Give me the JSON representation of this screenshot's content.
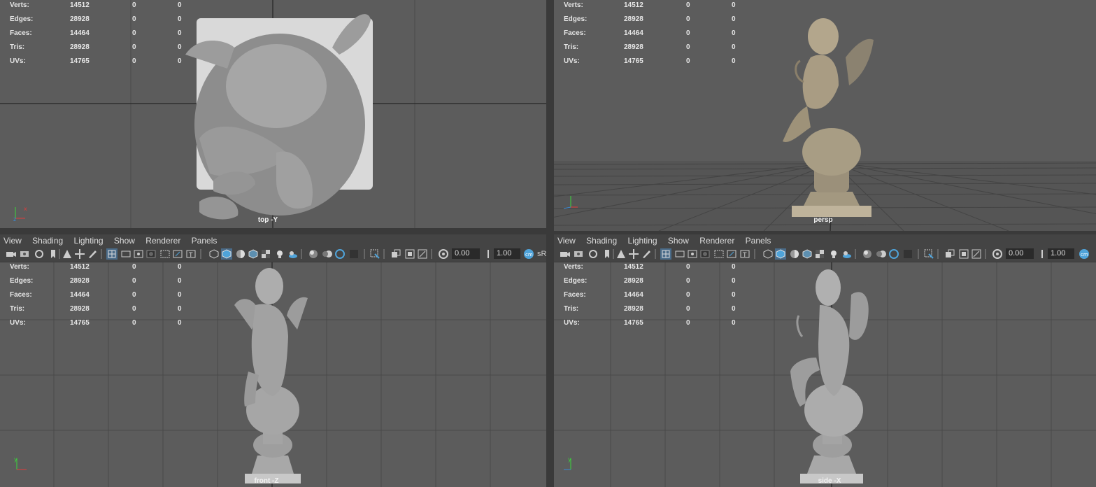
{
  "stats": {
    "labels": [
      "Verts:",
      "Edges:",
      "Faces:",
      "Tris:",
      "UVs:"
    ],
    "values": [
      "14512",
      "28928",
      "14464",
      "28928",
      "14765"
    ],
    "sel_a": [
      "0",
      "0",
      "0",
      "0",
      "0"
    ],
    "sel_b": [
      "0",
      "0",
      "0",
      "0",
      "0"
    ]
  },
  "viewports": {
    "top": {
      "camera": "top -Y"
    },
    "persp": {
      "camera": "persp"
    },
    "front": {
      "camera": "front -Z"
    },
    "side": {
      "camera": "side -X"
    }
  },
  "menu": [
    "View",
    "Shading",
    "Lighting",
    "Show",
    "Renderer",
    "Panels"
  ],
  "toolbar": {
    "exposure": "0.00",
    "gamma": "1.00",
    "color_space": "sR"
  },
  "colors": {
    "viewport_bg": "#5c5c5c",
    "grid_line": "#4a4a4a",
    "grid_axis": "#2e2e2e",
    "accent": "#4fa3d9"
  }
}
